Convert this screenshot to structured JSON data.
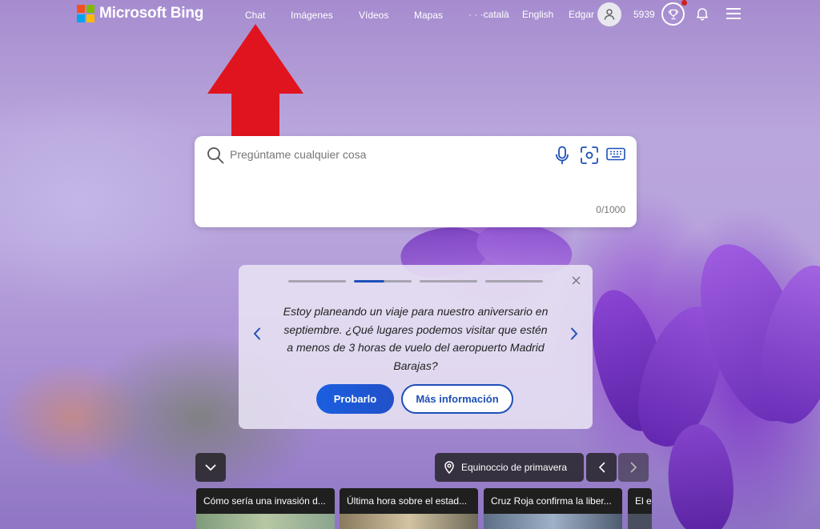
{
  "header": {
    "logo_text": "Microsoft Bing",
    "nav": [
      {
        "label": "Chat"
      },
      {
        "label": "Imágenes"
      },
      {
        "label": "Vídeos"
      },
      {
        "label": "Mapas"
      },
      {
        "label": "· · ·català"
      },
      {
        "label": "English"
      }
    ],
    "user_name": "Edgar",
    "points": "5939"
  },
  "search": {
    "placeholder": "Pregúntame cualquier cosa",
    "value": "",
    "char_count": "0/1000"
  },
  "suggestion": {
    "text": "Estoy planeando un viaje para nuestro aniversario en septiembre. ¿Qué lugares podemos visitar que estén a menos de 3 horas de vuelo del aeropuerto Madrid Barajas?",
    "try_label": "Probarlo",
    "more_label": "Más información",
    "slides": 4,
    "active_slide": 2
  },
  "bottom": {
    "location_label": "Equinoccio de primavera"
  },
  "news": [
    {
      "title": "Cómo sería una invasión d..."
    },
    {
      "title": "Última hora sobre el estad..."
    },
    {
      "title": "Cruz Roja confirma la liber..."
    },
    {
      "title": "El e"
    }
  ],
  "colors": {
    "accent": "#1e4fb8",
    "annotation_arrow": "#e0141e",
    "ms_red": "#f25022",
    "ms_green": "#7fba00",
    "ms_blue": "#00a4ef",
    "ms_yellow": "#ffb900"
  },
  "icons": [
    "search-icon",
    "mic-icon",
    "visual-search-icon",
    "keyboard-icon",
    "close-icon",
    "chevron-left-icon",
    "chevron-right-icon",
    "chevron-down-icon",
    "location-pin-icon",
    "trophy-icon",
    "bell-icon",
    "menu-icon",
    "user-icon"
  ]
}
